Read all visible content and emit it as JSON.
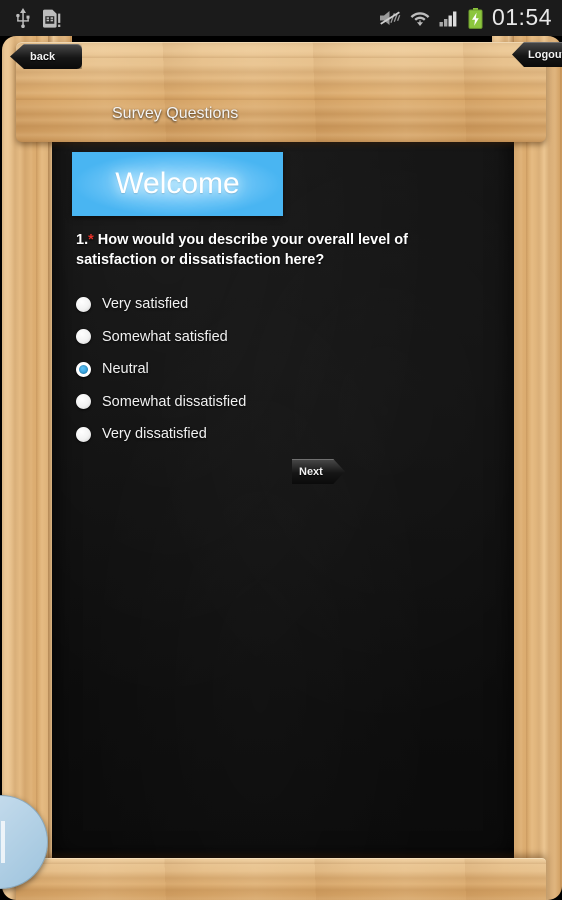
{
  "statusbar": {
    "time": "01:54",
    "icons_left": [
      "usb-icon",
      "sim-card-alert-icon"
    ],
    "icons_right": [
      "mute-vibrate-icon",
      "wifi-icon",
      "signal-bars-icon",
      "battery-charging-icon"
    ]
  },
  "nav": {
    "back_label": "back",
    "logout_label": "Logout"
  },
  "board": {
    "title": "Survey Questions",
    "banner_text": "Welcome",
    "banner_color": "#49b5f2",
    "question": {
      "number": "1.",
      "required_mark": "*",
      "text": "How would you describe your overall level of satisfaction or dissatisfaction here?"
    },
    "options": [
      {
        "label": "Very satisfied",
        "selected": false
      },
      {
        "label": "Somewhat satisfied",
        "selected": false
      },
      {
        "label": "Neutral",
        "selected": true
      },
      {
        "label": "Somewhat dissatisfied",
        "selected": false
      },
      {
        "label": "Very dissatisfied",
        "selected": false
      }
    ],
    "next_label": "Next"
  },
  "handle": {
    "name": "drag-handle"
  }
}
